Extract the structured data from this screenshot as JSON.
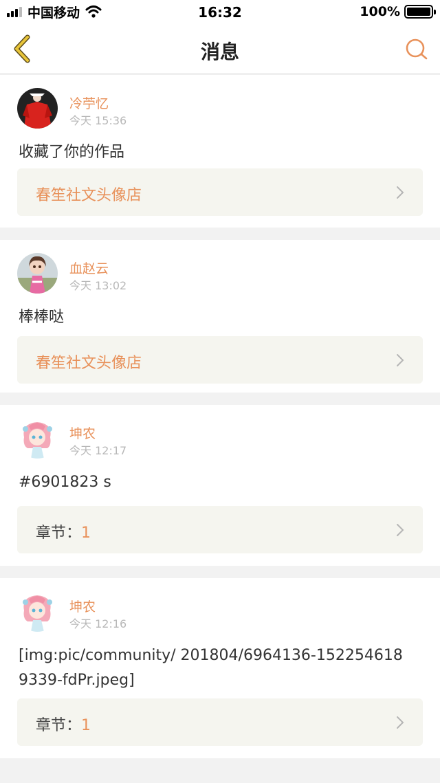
{
  "status": {
    "carrier": "中国移动",
    "time": "16:32",
    "battery": "100%"
  },
  "header": {
    "title": "消息"
  },
  "messages": [
    {
      "user": "冷苧忆",
      "time": "今天 15:36",
      "text": "收藏了你的作品",
      "ref_label": "春笙社文头像店",
      "ref_value": ""
    },
    {
      "user": "血赵云",
      "time": "今天 13:02",
      "text": "棒棒哒",
      "ref_label": "春笙社文头像店",
      "ref_value": ""
    },
    {
      "user": "坤农",
      "time": "今天 12:17",
      "text": "#6901823 s",
      "ref_label": "章节：",
      "ref_value": "1"
    },
    {
      "user": "坤农",
      "time": "今天 12:16",
      "text": "[img:pic/community/ 201804/6964136-1522546189339-fdPr.jpeg]",
      "ref_label": "章节：",
      "ref_value": "1"
    }
  ],
  "colors": {
    "accent": "#e8915a",
    "back_arrow": "#e8c53a"
  },
  "icons": {
    "back": "chevron-left-icon",
    "search": "search-icon",
    "row": "chevron-right-icon"
  }
}
